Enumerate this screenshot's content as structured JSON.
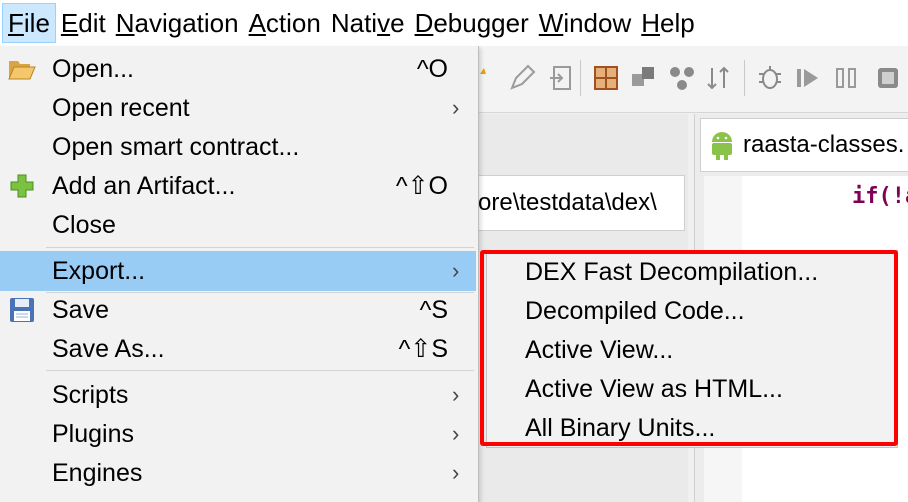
{
  "menubar": {
    "items": [
      {
        "label": "File",
        "accel": "F",
        "rest": "ile"
      },
      {
        "label": "Edit",
        "accel": "E",
        "rest": "dit"
      },
      {
        "label": "Navigation",
        "accel": "N",
        "rest": "avigation"
      },
      {
        "label": "Action",
        "accel": "A",
        "rest": "ction"
      },
      {
        "label": "Native",
        "pre": "Nati",
        "accel": "v",
        "rest": "e"
      },
      {
        "label": "Debugger",
        "accel": "D",
        "rest": "ebugger"
      },
      {
        "label": "Window",
        "accel": "W",
        "rest": "indow"
      },
      {
        "label": "Help",
        "accel": "H",
        "rest": "elp"
      }
    ]
  },
  "file_menu": {
    "items": [
      {
        "label": "Open...",
        "shortcut": "^O",
        "icon": "folder-open-icon"
      },
      {
        "label": "Open recent",
        "submenu": true
      },
      {
        "label": "Open smart contract..."
      },
      {
        "label": "Add an Artifact...",
        "shortcut": "^⇧O",
        "icon": "plus-icon"
      },
      {
        "label": "Close"
      },
      {
        "label": "Export...",
        "submenu": true,
        "highlighted": true
      },
      {
        "label": "Save",
        "shortcut": "^S",
        "icon": "floppy-disk-icon"
      },
      {
        "label": "Save As...",
        "shortcut": "^⇧S"
      },
      {
        "label": "Scripts",
        "submenu": true
      },
      {
        "label": "Plugins",
        "submenu": true
      },
      {
        "label": "Engines",
        "submenu": true
      }
    ],
    "submenu_arrow": "›"
  },
  "export_submenu": {
    "items": [
      "DEX Fast Decompilation...",
      "Decompiled Code...",
      "Active View...",
      "Active View as HTML...",
      "All Binary Units..."
    ]
  },
  "background": {
    "path_text": "ore\\testdata\\dex\\",
    "tab_label": "raasta-classes.",
    "code_text": "if(!a"
  },
  "colors": {
    "highlight": "#99ccf5",
    "menubar_active": "#cce8ff",
    "red_annotation": "#ff0000"
  }
}
